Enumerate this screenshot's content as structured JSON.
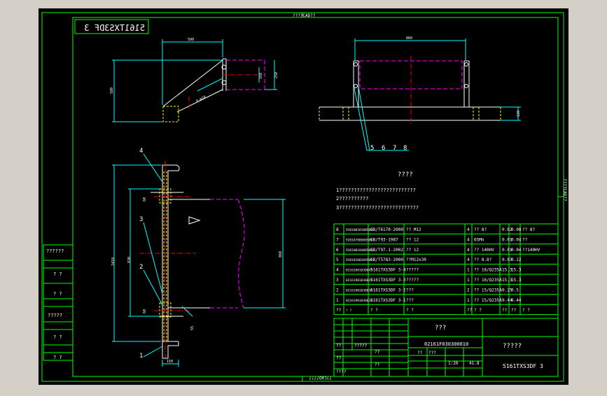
{
  "colors": {
    "background": "#000000",
    "frame": "#00ff00",
    "outline": "#ffffff",
    "text": "#ffffff",
    "dimension": "#00ffff",
    "hidden": "#ffff00",
    "phantom": "#ff00ff",
    "centerline": "#ff0000",
    "chrome": "#d4d0c8"
  },
  "frame": {
    "top_caption": "????CAD??",
    "bottom_caption": "??CAD????",
    "right_caption": "????CAD??",
    "mirrored_code": "5161TXS3DF 3"
  },
  "left_column": {
    "labels": [
      "??????",
      "? ?",
      "? ?",
      "?????",
      "? ?",
      "? ?"
    ]
  },
  "views": {
    "top_left": {
      "dims": [
        "500",
        "580",
        "160",
        "250",
        "4-φ18"
      ]
    },
    "top_right": {
      "dims": [
        "860",
        "120"
      ],
      "balloons": [
        "5",
        "6",
        "7",
        "8"
      ]
    },
    "section": {
      "dims": [
        "2410",
        "830",
        "60",
        "60",
        "860",
        "55",
        "150"
      ],
      "balloons": [
        "4",
        "3",
        "2",
        "1"
      ]
    }
  },
  "notes": {
    "title": "????",
    "lines": [
      "1??????????????????????????",
      "2??????????",
      "3???????????????????????????"
    ]
  },
  "bom": {
    "rows": [
      {
        "no": "8",
        "code": "92010020100500",
        "std": "GB/T6170-2000",
        "name": "?? M12",
        "qty": "4",
        "mat": "?? 8?",
        "w1": "0.02",
        "w2": "0.08",
        "note": "?? 8?"
      },
      {
        "no": "7",
        "code": "92010700600501",
        "std": "GB/T93-1987",
        "name": "?? 12",
        "qty": "4",
        "mat": "65Mn",
        "w1": "0.01",
        "w2": "0.04",
        "note": "??"
      },
      {
        "no": "6",
        "code": "92010010400500",
        "std": "GB/T97.1-2002",
        "name": "?? 12",
        "qty": "4",
        "mat": "?? 140HV",
        "w1": "0.01",
        "w2": "0.04",
        "note": "??140HV"
      },
      {
        "no": "5",
        "code": "92010100204901",
        "std": "GB/T5783-2000",
        "name": "??M12x30",
        "qty": "4",
        "mat": "?? 8.8?",
        "w1": "0.03",
        "w2": "0.12",
        "note": ""
      },
      {
        "no": "4",
        "code": "02161901030043",
        "std": "5161TXS3DF 3-4",
        "name": "?????",
        "qty": "1",
        "mat": "?? 16/Q235A",
        "w1": "15.3",
        "w2": "15.3",
        "note": ""
      },
      {
        "no": "3",
        "code": "02161901030043",
        "std": "5161TXS3DF 3-3",
        "name": "?????",
        "qty": "1",
        "mat": "?? 16/Q235A",
        "w1": "15.3",
        "w2": "15.3",
        "note": ""
      },
      {
        "no": "2",
        "code": "02161901030030",
        "std": "5161TXS3DF 3-2",
        "name": "???",
        "qty": "2",
        "mat": "?? 15/Q235A",
        "w1": "0.25",
        "w2": "0.5",
        "note": ""
      },
      {
        "no": "1",
        "code": "02161901030024",
        "std": "5161TXS3DF 3-1",
        "name": "???",
        "qty": "1",
        "mat": "?? 15/Q235A",
        "w1": "9.44",
        "w2": "9.44",
        "note": ""
      }
    ],
    "header": {
      "no": "??",
      "code": "? ?",
      "std": "? ?",
      "name": "? ?",
      "qty": "??",
      "mat": "? ?",
      "w1": "??",
      "w2": "??",
      "note": "? ?"
    }
  },
  "title_block": {
    "company": "???",
    "drawing_no_code": "02161F030300010",
    "part_name": "?????",
    "drawing_no": "5161TXS3DF 3",
    "scale": "1:20",
    "weight": "41.8",
    "sign_labels": [
      "??",
      "??",
      "?????",
      "????"
    ],
    "rev_labels": [
      "??",
      "??",
      "??",
      "???"
    ]
  }
}
